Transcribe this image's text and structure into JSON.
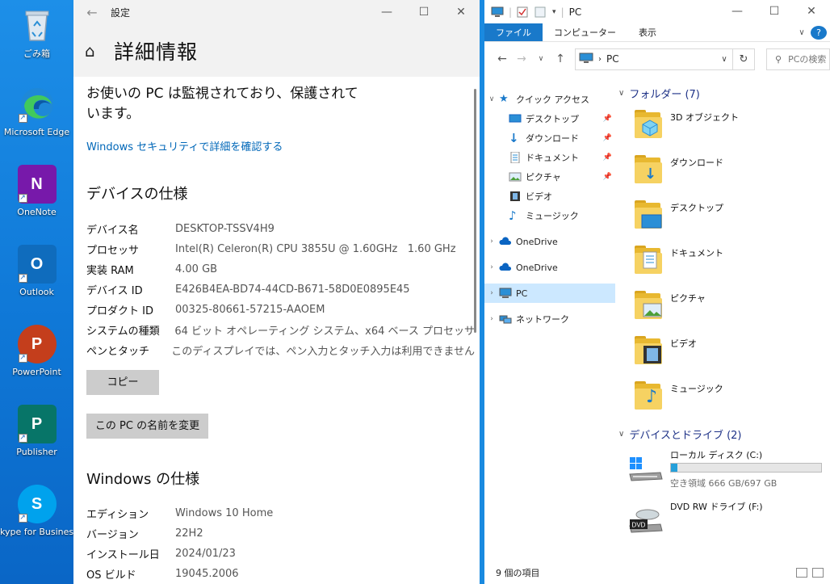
{
  "desktop": {
    "icons": [
      {
        "label": "ごみ箱",
        "icon": "recycle-bin-icon"
      },
      {
        "label": "Microsoft Edge",
        "icon": "edge-icon"
      },
      {
        "label": "OneNote",
        "icon": "onenote-icon",
        "letter": "N",
        "color": "#7719aa"
      },
      {
        "label": "Outlook",
        "icon": "outlook-icon",
        "letter": "O",
        "color": "#0f6cbd"
      },
      {
        "label": "PowerPoint",
        "icon": "powerpoint-icon",
        "letter": "P",
        "color": "#c43e1c"
      },
      {
        "label": "Publisher",
        "icon": "publisher-icon",
        "letter": "P",
        "color": "#077568"
      },
      {
        "label": "kype for Business",
        "icon": "skype-icon",
        "letter": "S",
        "color": "#00a2ed"
      }
    ]
  },
  "settings": {
    "window_title": "設定",
    "page_title": "詳細情報",
    "protection_text": "お使いの PC は監視されており、保護されています。",
    "security_link": "Windows セキュリティで詳細を確認する",
    "device_spec_heading": "デバイスの仕様",
    "device_spec": [
      {
        "key": "デバイス名",
        "value": "DESKTOP-TSSV4H9"
      },
      {
        "key": "プロセッサ",
        "value": "Intel(R) Celeron(R) CPU 3855U @ 1.60GHz   1.60 GHz"
      },
      {
        "key": "実装 RAM",
        "value": "4.00 GB"
      },
      {
        "key": "デバイス ID",
        "value": "E426B4EA-BD74-44CD-B671-58D0E0895E45"
      },
      {
        "key": "プロダクト ID",
        "value": "00325-80661-57215-AAOEM"
      },
      {
        "key": "システムの種類",
        "value": "64 ビット オペレーティング システム、x64 ベース プロセッサ"
      },
      {
        "key": "ペンとタッチ",
        "value": "このディスプレイでは、ペン入力とタッチ入力は利用できません"
      }
    ],
    "copy_button": "コピー",
    "rename_button": "この PC の名前を変更",
    "windows_spec_heading": "Windows の仕様",
    "windows_spec": [
      {
        "key": "エディション",
        "value": "Windows 10 Home"
      },
      {
        "key": "バージョン",
        "value": "22H2"
      },
      {
        "key": "インストール日",
        "value": "2024/01/23"
      },
      {
        "key": "OS ビルド",
        "value": "19045.2006"
      }
    ]
  },
  "explorer": {
    "window_title": "PC",
    "ribbon_tabs": [
      "ファイル",
      "コンピューター",
      "表示"
    ],
    "address": "PC",
    "search_placeholder": "PCの検索",
    "nav_items": [
      {
        "label": "クイック アクセス",
        "icon": "star-icon",
        "pinned": false
      },
      {
        "label": "デスクトップ",
        "icon": "desktop-icon",
        "pinned": true
      },
      {
        "label": "ダウンロード",
        "icon": "download-icon",
        "pinned": true
      },
      {
        "label": "ドキュメント",
        "icon": "document-icon",
        "pinned": true
      },
      {
        "label": "ピクチャ",
        "icon": "pictures-icon",
        "pinned": true
      },
      {
        "label": "ビデオ",
        "icon": "video-icon",
        "pinned": false
      },
      {
        "label": "ミュージック",
        "icon": "music-icon",
        "pinned": false
      },
      {
        "label": "OneDrive",
        "icon": "cloud-icon",
        "pinned": false
      },
      {
        "label": "OneDrive",
        "icon": "cloud-icon",
        "pinned": false
      },
      {
        "label": "PC",
        "icon": "pc-icon",
        "pinned": false,
        "selected": true
      },
      {
        "label": "ネットワーク",
        "icon": "network-icon",
        "pinned": false
      }
    ],
    "folders_heading": "フォルダー (7)",
    "folders": [
      {
        "name": "3D オブジェクト",
        "icon": "3d-objects-icon"
      },
      {
        "name": "ダウンロード",
        "icon": "download-folder-icon"
      },
      {
        "name": "デスクトップ",
        "icon": "desktop-folder-icon"
      },
      {
        "name": "ドキュメント",
        "icon": "documents-folder-icon"
      },
      {
        "name": "ピクチャ",
        "icon": "pictures-folder-icon"
      },
      {
        "name": "ビデオ",
        "icon": "videos-folder-icon"
      },
      {
        "name": "ミュージック",
        "icon": "music-folder-icon"
      }
    ],
    "drives_heading": "デバイスとドライブ (2)",
    "drives": [
      {
        "name": "ローカル ディスク (C:)",
        "free_text": "空き領域 666 GB/697 GB",
        "used_fraction": 0.045,
        "icon": "local-disk-icon"
      },
      {
        "name": "DVD RW ドライブ (F:)",
        "icon": "dvd-drive-icon"
      }
    ],
    "status_text": "9 個の項目"
  },
  "colors": {
    "accent": "#0067b8",
    "ribbon_file": "#1979ca",
    "selection": "#cce8ff",
    "drive_bar": "#26a0da"
  }
}
